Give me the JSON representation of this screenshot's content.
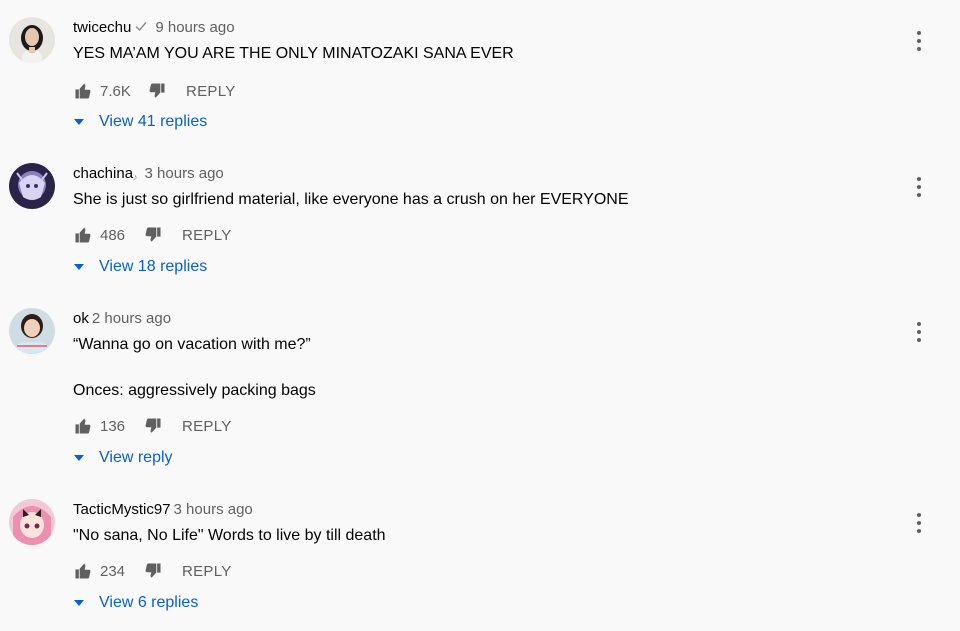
{
  "comments": [
    {
      "author": "twicechu",
      "verified": true,
      "badge": "",
      "time": "9 hours ago",
      "text": "YES MA’AM YOU ARE THE ONLY MINATOZAKI SANA EVER",
      "likes": "7.6K",
      "reply_label": "REPLY",
      "view_replies": "View 41 replies",
      "avatar": "woman-portrait-avatar"
    },
    {
      "author": "chachina",
      "verified": false,
      "badge": "♪",
      "time": "3 hours ago",
      "text": "She is just so girlfriend material, like everyone has a crush on her EVERYONE",
      "likes": "486",
      "reply_label": "REPLY",
      "view_replies": "View 18 replies",
      "avatar": "anime-art-avatar"
    },
    {
      "author": "ok",
      "verified": false,
      "badge": "",
      "time": "2 hours ago",
      "text": "“Wanna go on vacation with me?”\n\nOnces: aggressively packing bags",
      "likes": "136",
      "reply_label": "REPLY",
      "view_replies": "View reply",
      "avatar": "girl-photo-avatar"
    },
    {
      "author": "TacticMystic97",
      "verified": false,
      "badge": "",
      "time": "3 hours ago",
      "text": "\"No sana, No Life\" Words to live by till death",
      "likes": "234",
      "reply_label": "REPLY",
      "view_replies": "View 6 replies",
      "avatar": "pink-hair-anime-avatar"
    }
  ],
  "colors": {
    "background": "#f9f9f9",
    "link_blue": "#065fd4",
    "secondary_text": "#606060"
  }
}
